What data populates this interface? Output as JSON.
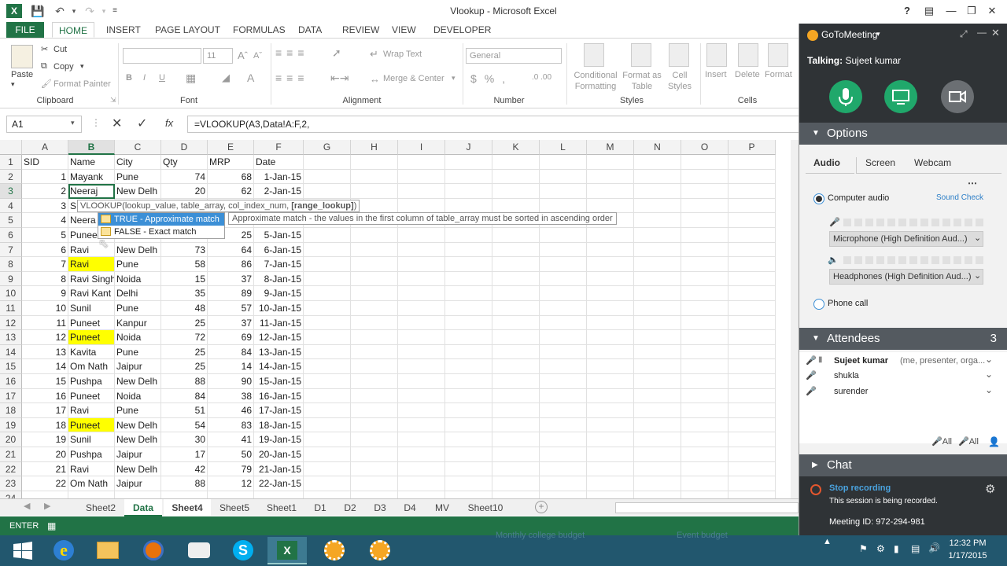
{
  "window": {
    "title": "Vlookup - Microsoft Excel"
  },
  "ribbon": {
    "tabs": [
      "FILE",
      "HOME",
      "INSERT",
      "PAGE LAYOUT",
      "FORMULAS",
      "DATA",
      "REVIEW",
      "VIEW",
      "DEVELOPER"
    ],
    "clipboard": {
      "paste": "Paste",
      "cut": "Cut",
      "copy": "Copy",
      "format_painter": "Format Painter",
      "label": "Clipboard"
    },
    "font": {
      "size": "11",
      "bold": "B",
      "italic": "I",
      "underline": "U",
      "label": "Font"
    },
    "alignment": {
      "wrap": "Wrap Text",
      "merge": "Merge & Center",
      "label": "Alignment"
    },
    "number": {
      "format": "General",
      "label": "Number"
    },
    "styles": {
      "conditional": "Conditional Formatting",
      "format_as_table": "Format as Table",
      "cell_styles": "Cell Styles",
      "label": "Styles"
    },
    "cells": {
      "insert": "Insert",
      "delete": "Delete",
      "format": "Format",
      "label": "Cells"
    }
  },
  "formula_bar": {
    "namebox": "A1",
    "formula": "=VLOOKUP(A3,Data!A:F,2,"
  },
  "grid": {
    "columns": [
      "A",
      "B",
      "C",
      "D",
      "E",
      "F",
      "G",
      "H",
      "I",
      "J",
      "K",
      "L",
      "M",
      "N",
      "O",
      "P"
    ],
    "rows": [
      [
        "SID",
        "Name",
        "City",
        "Qty",
        "MRP",
        "Date"
      ],
      [
        "1",
        "Mayank",
        "Pune",
        "74",
        "68",
        "1-Jan-15"
      ],
      [
        "2",
        "Neeraj",
        "New Delh",
        "20",
        "62",
        "2-Jan-15"
      ],
      [
        "3",
        "S",
        "",
        "",
        "",
        ""
      ],
      [
        "4",
        "Neera",
        "",
        "",
        "",
        ""
      ],
      [
        "5",
        "Punee",
        "",
        "",
        "25",
        "5-Jan-15"
      ],
      [
        "6",
        "Ravi",
        "New Delh",
        "73",
        "64",
        "6-Jan-15"
      ],
      [
        "7",
        "Ravi",
        "Pune",
        "58",
        "86",
        "7-Jan-15"
      ],
      [
        "8",
        "Ravi Singh",
        "Noida",
        "15",
        "37",
        "8-Jan-15"
      ],
      [
        "9",
        "Ravi Kant",
        "Delhi",
        "35",
        "89",
        "9-Jan-15"
      ],
      [
        "10",
        "Sunil",
        "Pune",
        "48",
        "57",
        "10-Jan-15"
      ],
      [
        "11",
        "Puneet",
        "Kanpur",
        "25",
        "37",
        "11-Jan-15"
      ],
      [
        "12",
        "Puneet",
        "Noida",
        "72",
        "69",
        "12-Jan-15"
      ],
      [
        "13",
        "Kavita",
        "Pune",
        "25",
        "84",
        "13-Jan-15"
      ],
      [
        "14",
        "Om Nath",
        "Jaipur",
        "25",
        "14",
        "14-Jan-15"
      ],
      [
        "15",
        "Pushpa",
        "New Delh",
        "88",
        "90",
        "15-Jan-15"
      ],
      [
        "16",
        "Puneet",
        "Noida",
        "84",
        "38",
        "16-Jan-15"
      ],
      [
        "17",
        "Ravi",
        "Pune",
        "51",
        "46",
        "17-Jan-15"
      ],
      [
        "18",
        "Puneet",
        "New Delh",
        "54",
        "83",
        "18-Jan-15"
      ],
      [
        "19",
        "Sunil",
        "New Delh",
        "30",
        "41",
        "19-Jan-15"
      ],
      [
        "20",
        "Pushpa",
        "Jaipur",
        "17",
        "50",
        "20-Jan-15"
      ],
      [
        "21",
        "Ravi",
        "New Delh",
        "42",
        "79",
        "21-Jan-15"
      ],
      [
        "22",
        "Om Nath",
        "Jaipur",
        "88",
        "12",
        "22-Jan-15"
      ]
    ],
    "highlighted_rows": [
      8,
      13,
      19
    ]
  },
  "autocomplete": {
    "signature_prefix": "VLOOKUP(lookup_value, table_array, col_index_num, ",
    "signature_bold": "[range_lookup]",
    "signature_suffix": ")",
    "options": [
      "TRUE - Approximate match",
      "FALSE - Exact match"
    ],
    "hint": "Approximate match - the values in the first column of table_array must be sorted in ascending order"
  },
  "sheets": [
    "Sheet2",
    "Data",
    "Sheet4",
    "Sheet5",
    "Sheet1",
    "D1",
    "D2",
    "D3",
    "D4",
    "MV",
    "Sheet10"
  ],
  "status": {
    "mode": "ENTER"
  },
  "gotomeeting": {
    "app": "GoToMeeting",
    "talking_label": "Talking:",
    "talking_name": "Sujeet kumar",
    "options_title": "Options",
    "tabs": [
      "Audio",
      "Screen",
      "Webcam"
    ],
    "computer_audio": "Computer audio",
    "sound_check": "Sound Check",
    "microphone": "Microphone (High Definition Aud...)",
    "headphones": "Headphones (High Definition Aud...)",
    "phone_call": "Phone call",
    "attendees_title": "Attendees",
    "attendees_count": "3",
    "attendees": [
      {
        "name": "Sujeet kumar",
        "role": "(me, presenter, orga..."
      },
      {
        "name": "shukla",
        "role": ""
      },
      {
        "name": "surender",
        "role": ""
      }
    ],
    "all_label": "All",
    "chat_title": "Chat",
    "stop_recording": "Stop recording",
    "recording_note": "This session is being recorded.",
    "meeting_id": "Meeting ID: 972-294-981"
  },
  "taskbar": {
    "time": "12:32 PM",
    "date": "1/17/2015",
    "behind_text_1": "Monthly college budget",
    "behind_text_2": "Event budget"
  },
  "colors": {
    "excel_green": "#217346",
    "highlight": "#ffff00",
    "gtm_dark": "#2f3336",
    "gtm_green": "#20a86b",
    "gtm_gray": "#6b6f73",
    "taskbar": "#22576e"
  }
}
